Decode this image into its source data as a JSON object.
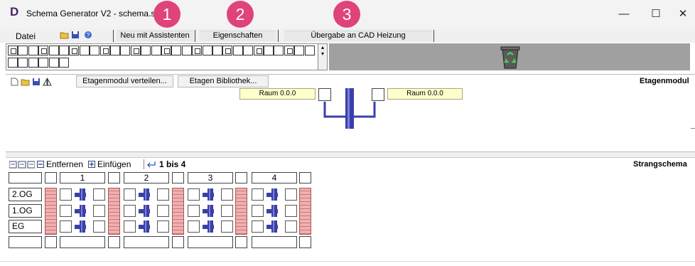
{
  "window": {
    "title": "Schema Generator V2  -  schema.sg",
    "controls": {
      "minimize": "—",
      "maximize": "☐",
      "close": "✕"
    }
  },
  "badges": [
    "1",
    "2",
    "3"
  ],
  "menu": {
    "file_label": "Datei",
    "tabs": [
      "Neu mit Assistenten",
      "Eigenschaften",
      "Übergabe an CAD Heizung"
    ]
  },
  "etagenmodul": {
    "title": "Etagenmodul",
    "buttons": [
      "Etagenmodul verteilen...",
      "Etagen Bibliothek..."
    ],
    "raum_left": "Raum 0.0.0",
    "raum_right": "Raum 0.0.0"
  },
  "strang": {
    "title": "Strangschema",
    "toolbar": {
      "remove_label": "Entfernen",
      "insert_label": "Einfügen",
      "range_label": "1 bis  4"
    },
    "columns": [
      "1",
      "2",
      "3",
      "4"
    ],
    "floors": [
      "2.OG",
      "1.OG",
      "EG"
    ]
  },
  "colors": {
    "badge": "#e0427b",
    "pipe": "#3a3fa8",
    "raum_bg": "#ffffcc",
    "brick": "#f0b0b0"
  }
}
